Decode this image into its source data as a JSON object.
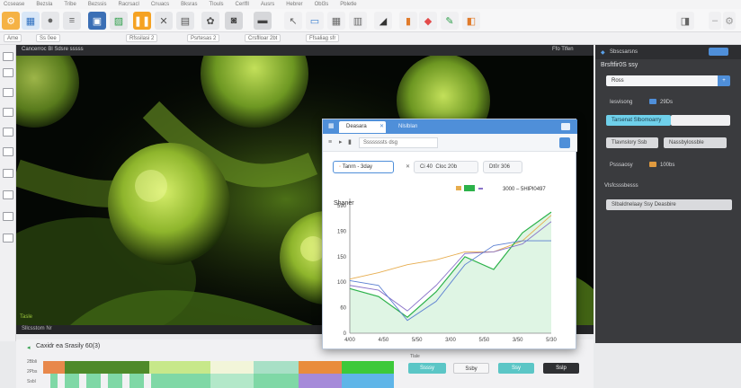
{
  "menu": {
    "items": [
      "Ccsease",
      "Bezsla",
      "Tribe",
      "Bezssis",
      "Racrsacl",
      "Cnuacs",
      "Bksras",
      "Tlouls",
      "Cerlfll",
      "Ausrs",
      "Hebrer",
      "Obl3s",
      "Pbletle"
    ]
  },
  "address": {
    "a": "Ame",
    "b": "Ss 0ee",
    "c": "Rfssilasi 2",
    "d": "Psrtesas 2",
    "e": "Crsflloar 2bt",
    "f": "Ffsaliag sfr"
  },
  "viewer": {
    "header": "Cancerroc Bl Sdsre sssss",
    "header_right": "Ffo Tlfen",
    "label": "Tasle",
    "footer": "Sllcsstom Nr"
  },
  "dialog": {
    "tab_active": "Deasara",
    "tab_close": "✕",
    "tab_second": "Nlslblan",
    "sub_label": "Sssssssts dsg",
    "field_main": "Tanrn - 3day",
    "field_x": "✕",
    "field_b": "Ci 40",
    "field_c": "Cloc 20b",
    "field_d": "Dt0r 306",
    "legend_text": "3000 – 5HlPl0497"
  },
  "right_panel": {
    "title": "Sbscsarsns",
    "subtitle": "Brsftfir0S ssy",
    "input_value": "Ross",
    "row1_label": "Iesvisong",
    "row1_value": "29Ds",
    "selected": "Tarsenat Slbomoarry",
    "tag_a": "Tlavnslory Ssb",
    "tag_b": "Nassbylossble",
    "row2_label": "Psssaosy",
    "row2_value": "100bs",
    "section": "Vlsfcsssbesss",
    "bottom_field": "Slbaldnelaay Ssy Deasbire"
  },
  "bottom": {
    "title": "Caxidr ea Srasily 60(3)",
    "label_top": "2Bbli",
    "label_mid": "2Pbs",
    "label_bot": "Ssbl",
    "panel_label": "Tlale",
    "btn1": "Ssssy",
    "btn2": "Ssby",
    "btn3": "Ssy",
    "btn4": "Sslp"
  },
  "chart_data": {
    "type": "line",
    "title": "Shaner",
    "xlabel": "",
    "ylabel": "",
    "x_tick_labels": [
      "4/00",
      "4/50",
      "5/50",
      "3/00",
      "5/50",
      "3/50",
      "5/30"
    ],
    "y_tick_labels": [
      "0",
      "60",
      "100",
      "150",
      "190",
      "590"
    ],
    "series": [
      {
        "values": [
          170,
          190,
          215,
          230,
          255,
          255,
          290,
          370
        ]
      },
      {
        "values": [
          140,
          115,
          50,
          130,
          240,
          200,
          315,
          380
        ]
      },
      {
        "values": [
          150,
          135,
          70,
          150,
          250,
          255,
          280,
          350
        ]
      },
      {
        "values": [
          165,
          150,
          40,
          100,
          215,
          275,
          290,
          290
        ]
      }
    ]
  },
  "colors": {
    "accent": "#4f8fd9",
    "series": [
      "#e7ad4f",
      "#2cb24a",
      "#8a73c9",
      "#5b7fd1"
    ],
    "area": "#dff5e4"
  },
  "icons": {
    "close": "✕",
    "chevron": "▾",
    "pin": "◆"
  }
}
